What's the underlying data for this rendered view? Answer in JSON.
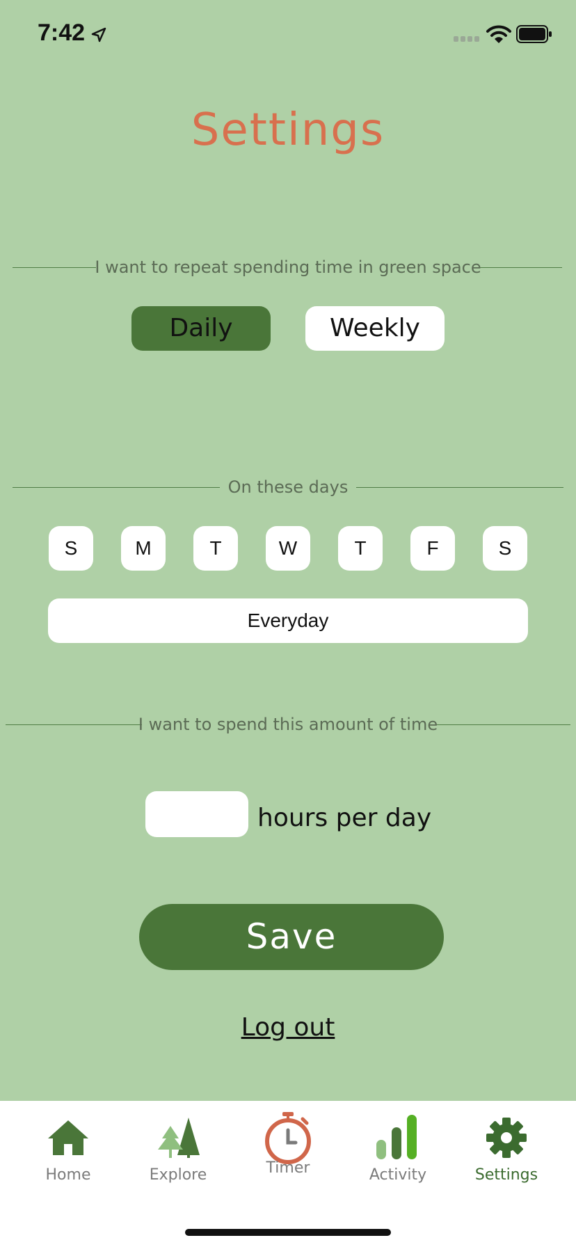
{
  "status_bar": {
    "time": "7:42"
  },
  "page": {
    "title": "Settings"
  },
  "repeat_section": {
    "label": "I want to repeat spending time in green space",
    "options": [
      "Daily",
      "Weekly"
    ],
    "selected": "Daily"
  },
  "days_section": {
    "label": "On these days",
    "days": [
      "S",
      "M",
      "T",
      "W",
      "T",
      "F",
      "S"
    ],
    "everyday_label": "Everyday"
  },
  "time_section": {
    "label": "I want to spend this amount of time",
    "hours_value": "",
    "unit_label": "hours per day"
  },
  "actions": {
    "save_label": "Save",
    "logout_label": "Log out"
  },
  "tab_bar": {
    "tabs": [
      {
        "label": "Home",
        "icon": "home-icon"
      },
      {
        "label": "Explore",
        "icon": "trees-icon"
      },
      {
        "label": "Timer",
        "icon": "stopwatch-icon"
      },
      {
        "label": "Activity",
        "icon": "bar-chart-icon"
      },
      {
        "label": "Settings",
        "icon": "gear-icon"
      }
    ],
    "active": "Settings"
  },
  "colors": {
    "background": "#afd0a6",
    "accent": "#4a7639",
    "title": "#d8704e"
  }
}
